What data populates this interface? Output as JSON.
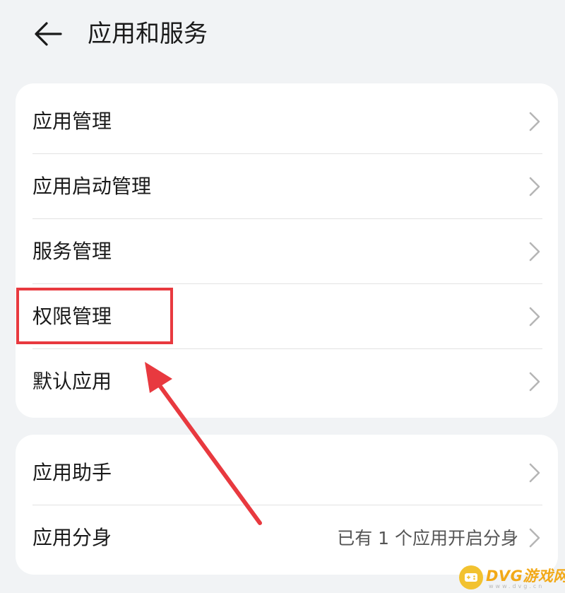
{
  "header": {
    "title": "应用和服务"
  },
  "group1": {
    "items": [
      {
        "label": "应用管理"
      },
      {
        "label": "应用启动管理"
      },
      {
        "label": "服务管理"
      },
      {
        "label": "权限管理"
      },
      {
        "label": "默认应用"
      }
    ]
  },
  "group2": {
    "items": [
      {
        "label": "应用助手"
      },
      {
        "label": "应用分身",
        "value": "已有 1 个应用开启分身"
      }
    ]
  },
  "watermark": {
    "text": "DVG游戏网",
    "sub": "www.dvg.cn"
  },
  "colors": {
    "background": "#f1f3f5",
    "card": "#ffffff",
    "annotation": "#e8393f",
    "watermark": "#f2a917"
  },
  "icons": {
    "back": "arrow-left-icon",
    "chevron": "chevron-right-icon",
    "logo": "gamepad-icon"
  }
}
